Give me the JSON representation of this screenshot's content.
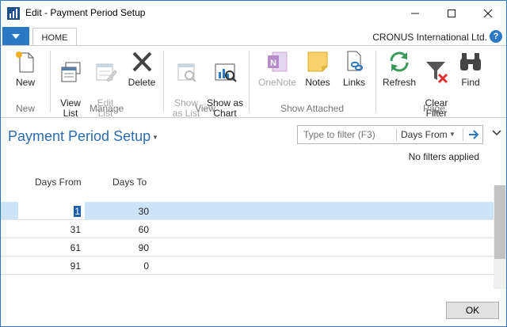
{
  "window": {
    "title": "Edit - Payment Period Setup"
  },
  "ribbon": {
    "tab": "HOME",
    "company": "CRONUS International Ltd.",
    "help": "?",
    "groups": [
      {
        "label": "New",
        "buttons": [
          {
            "label": "New",
            "icon": "new-document-icon",
            "enabled": true
          }
        ]
      },
      {
        "label": "Manage",
        "buttons": [
          {
            "label": "View\nList",
            "icon": "view-list-icon",
            "enabled": true
          },
          {
            "label": "Edit\nList",
            "icon": "edit-list-icon",
            "enabled": false
          },
          {
            "label": "Delete",
            "icon": "delete-icon",
            "enabled": true
          }
        ]
      },
      {
        "label": "View",
        "buttons": [
          {
            "label": "Show\nas List",
            "icon": "show-as-list-icon",
            "enabled": false
          },
          {
            "label": "Show as\nChart",
            "icon": "show-as-chart-icon",
            "enabled": true
          }
        ]
      },
      {
        "label": "Show Attached",
        "buttons": [
          {
            "label": "OneNote",
            "icon": "onenote-icon",
            "enabled": false
          },
          {
            "label": "Notes",
            "icon": "notes-icon",
            "enabled": true
          },
          {
            "label": "Links",
            "icon": "links-icon",
            "enabled": true
          }
        ]
      },
      {
        "label": "Page",
        "buttons": [
          {
            "label": "Refresh",
            "icon": "refresh-icon",
            "enabled": true
          },
          {
            "label": "Clear\nFilter",
            "icon": "clear-filter-icon",
            "enabled": true
          },
          {
            "label": "Find",
            "icon": "find-icon",
            "enabled": true
          }
        ]
      }
    ]
  },
  "page": {
    "title": "Payment Period Setup",
    "filter": {
      "placeholder": "Type to filter (F3)",
      "field": "Days From"
    },
    "filter_status": "No filters applied"
  },
  "grid": {
    "columns": [
      "Days From",
      "Days To"
    ],
    "rows": [
      {
        "days_from": "1",
        "days_to": "30",
        "selected": true
      },
      {
        "days_from": "31",
        "days_to": "60",
        "selected": false
      },
      {
        "days_from": "61",
        "days_to": "90",
        "selected": false
      },
      {
        "days_from": "91",
        "days_to": "0",
        "selected": false
      }
    ]
  },
  "footer": {
    "ok_label": "OK"
  },
  "colors": {
    "accent": "#2b78c5",
    "title": "#2b6cb0",
    "selection": "#cde3f8"
  }
}
